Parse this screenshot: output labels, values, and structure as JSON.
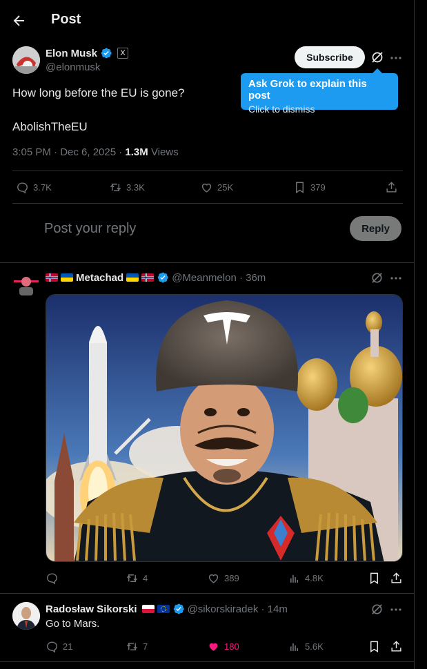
{
  "header": {
    "title": "Post",
    "back_icon": "arrow-left-icon"
  },
  "main_post": {
    "author_name": "Elon Musk",
    "handle": "@elonmusk",
    "affiliate_badge": "X",
    "subscribe_label": "Subscribe",
    "text_line1": "How long before the EU is gone?",
    "text_line2": "AbolishTheEU",
    "timestamp": "3:05 PM · Dec 6, 2025 · ",
    "views_count": "1.3M",
    "views_label": " Views",
    "stats": {
      "replies": "3.7K",
      "reposts": "3.3K",
      "likes": "25K",
      "bookmarks": "379"
    }
  },
  "grok_tooltip": {
    "title": "Ask Grok to explain this post",
    "subtitle": "Click to dismiss"
  },
  "composer": {
    "placeholder": "Post your reply",
    "reply_label": "Reply"
  },
  "replies": [
    {
      "author_name": "Metachad",
      "handle_time": "@Meanmelon · 36m",
      "stats": {
        "replies": "",
        "reposts": "4",
        "likes": "389",
        "views": "4.8K"
      },
      "image_label": "AI-generated portrait"
    },
    {
      "author_name": "Radosław Sikorski",
      "handle_time": "@sikorskiradek · 14m",
      "text": "Go to Mars.",
      "stats": {
        "replies": "21",
        "reposts": "7",
        "likes": "180",
        "views": "5.6K"
      }
    }
  ],
  "colors": {
    "accent": "#1d9bf0",
    "like_active": "#f91880",
    "muted": "#71767b",
    "border": "#2f3336"
  }
}
